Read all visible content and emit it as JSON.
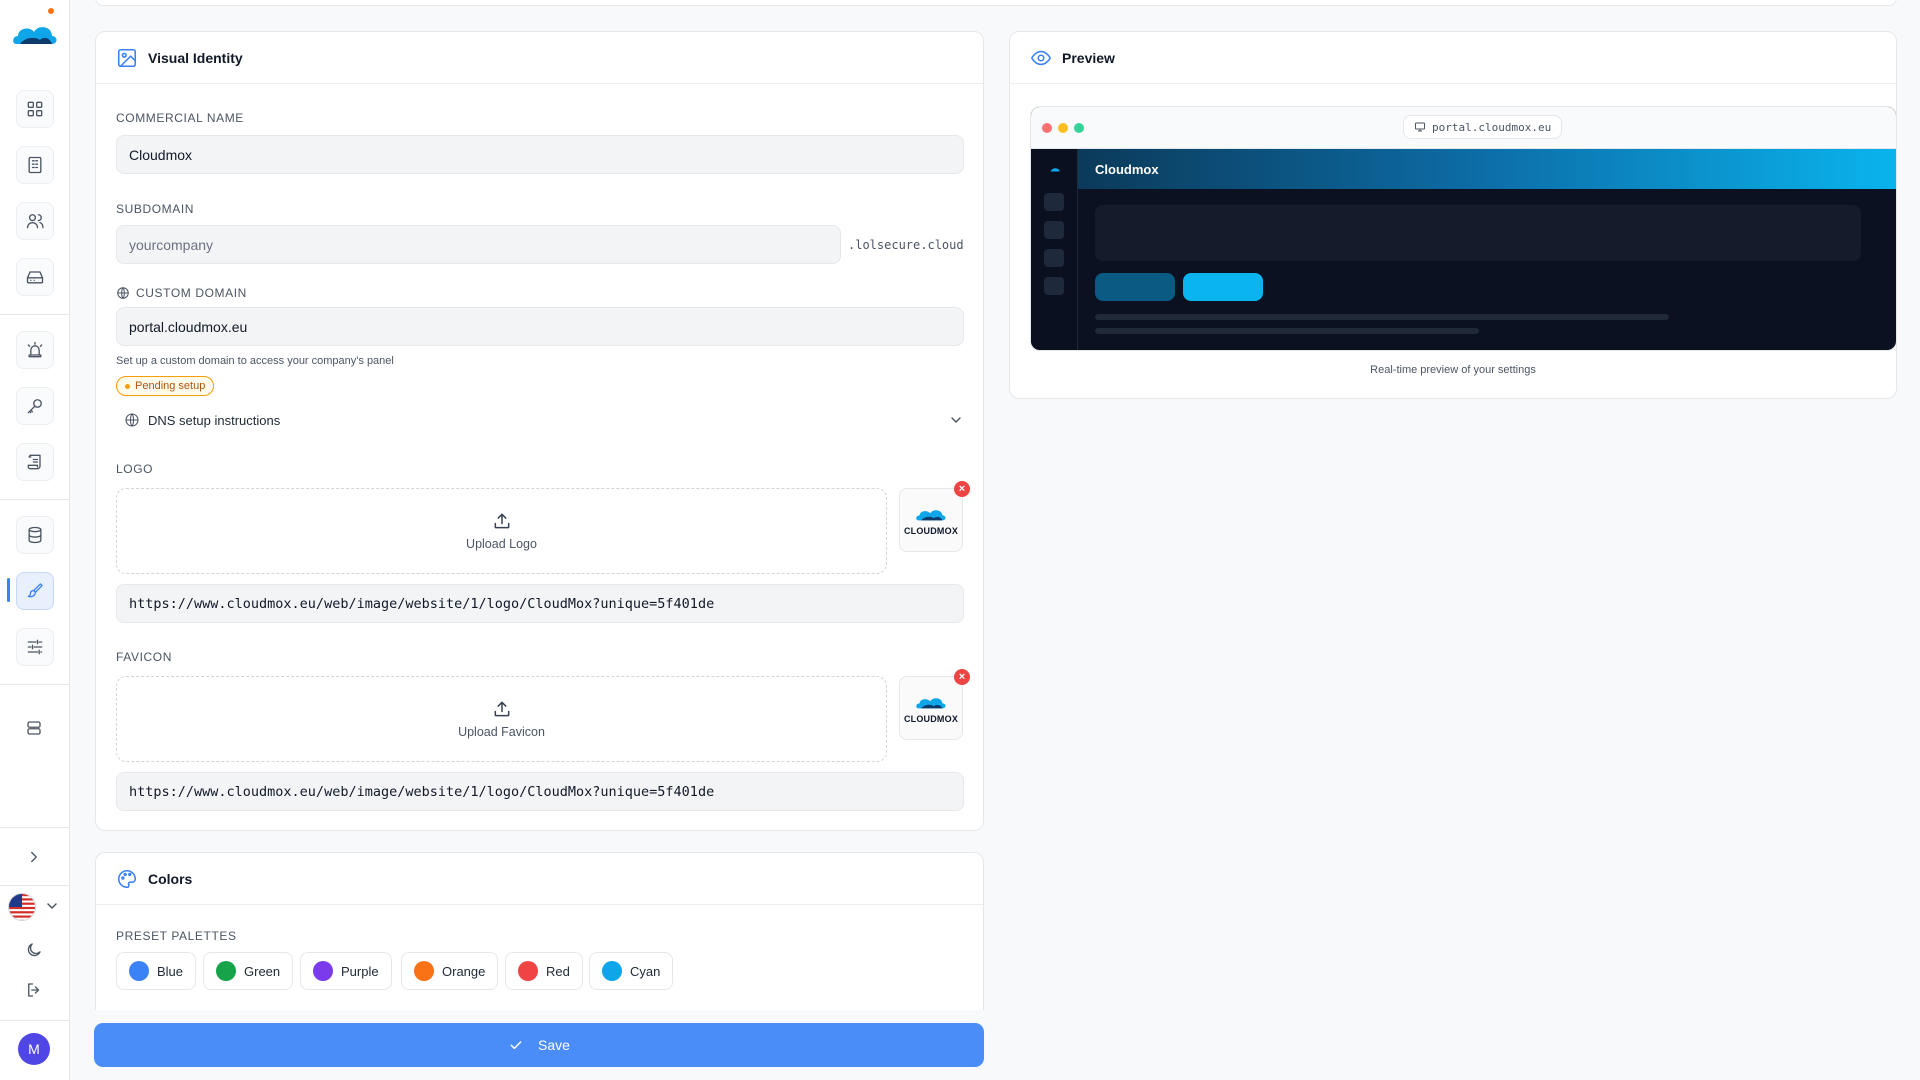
{
  "visual_identity": {
    "title": "Visual Identity",
    "commercial_name_label": "COMMERCIAL NAME",
    "commercial_name_value": "Cloudmox",
    "subdomain_label": "SUBDOMAIN",
    "subdomain_placeholder": "yourcompany",
    "subdomain_suffix": ".lolsecure.cloud",
    "custom_domain_label": "CUSTOM DOMAIN",
    "custom_domain_value": "portal.cloudmox.eu",
    "custom_domain_hint": "Set up a custom domain to access your company's panel",
    "pending_badge": "Pending setup",
    "dns_instructions": "DNS setup instructions",
    "logo_label": "LOGO",
    "upload_logo": "Upload Logo",
    "logo_url": "https://www.cloudmox.eu/web/image/website/1/logo/CloudMox?unique=5f401de",
    "favicon_label": "FAVICON",
    "upload_favicon": "Upload Favicon",
    "favicon_url": "https://www.cloudmox.eu/web/image/website/1/logo/CloudMox?unique=5f401de",
    "thumb_brand": "CLOUDMOX",
    "remove_glyph": "×"
  },
  "preview": {
    "title": "Preview",
    "url": "portal.cloudmox.eu",
    "app_name": "Cloudmox",
    "caption": "Real-time preview of your settings"
  },
  "colors": {
    "title": "Colors",
    "preset_label": "PRESET PALETTES",
    "palettes": [
      {
        "name": "Blue",
        "color": "#3b82f6"
      },
      {
        "name": "Green",
        "color": "#16a34a"
      },
      {
        "name": "Purple",
        "color": "#7c3aed"
      },
      {
        "name": "Orange",
        "color": "#f97316"
      },
      {
        "name": "Red",
        "color": "#ef4444"
      },
      {
        "name": "Cyan",
        "color": "#0ea5e9"
      }
    ]
  },
  "save_label": "Save",
  "user_initial": "M",
  "theme": {
    "accent": "#3b82f6",
    "save_bg": "#4b8df8"
  }
}
